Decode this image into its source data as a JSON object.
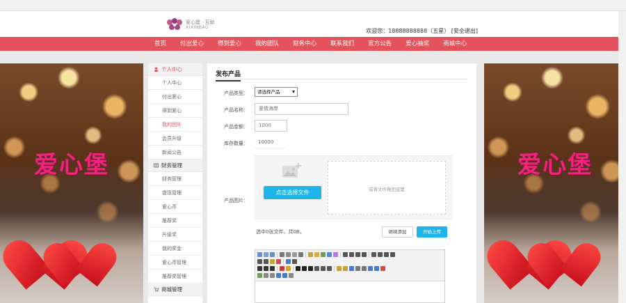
{
  "header": {
    "logo_cn": "爱心堡 · 互助",
    "logo_en": "AIXINBAO",
    "welcome": "欢迎您：18888888888（五星）",
    "logout": "[安全退出]"
  },
  "nav": {
    "items": [
      "首页",
      "付出爱心",
      "得到爱心",
      "我的团队",
      "财务中心",
      "联系我们",
      "官方公告",
      "爱心抽奖",
      "商城中心"
    ]
  },
  "banner": {
    "text": "爱心堡"
  },
  "sidebar": {
    "group_personal": "个人中心",
    "personal_items": [
      "个人中心",
      "付出爱心",
      "得到爱心",
      "我的团队",
      "会员升级",
      "新闻公告"
    ],
    "group_finance": "财务管理",
    "finance_items": [
      "财务管理",
      "提现管理",
      "爱心币",
      "推荐奖",
      "升级奖",
      "我的奖金",
      "爱心币管理",
      "推荐奖管理"
    ],
    "group_mall": "商城管理"
  },
  "main": {
    "title": "发布产品",
    "type_label": "产品类型：",
    "type_value": "请选择产品",
    "name_label": "产品名称：",
    "name_value": "爱情海岸",
    "price_label": "产品金额：",
    "price_value": "1000",
    "stock_label": "库存数量：",
    "stock_value": "10000",
    "image_label": "产品图片：",
    "choose_btn": "点击选择文件",
    "drop_hint": "或将文件拖到这里",
    "upload_status": "选中0张文件，共0B。",
    "continue_btn": "继续添加",
    "start_btn": "开始上传"
  },
  "colors": {
    "brand": "#e4525c",
    "accent": "#1fb5e8",
    "banner_text": "#f0247c"
  }
}
